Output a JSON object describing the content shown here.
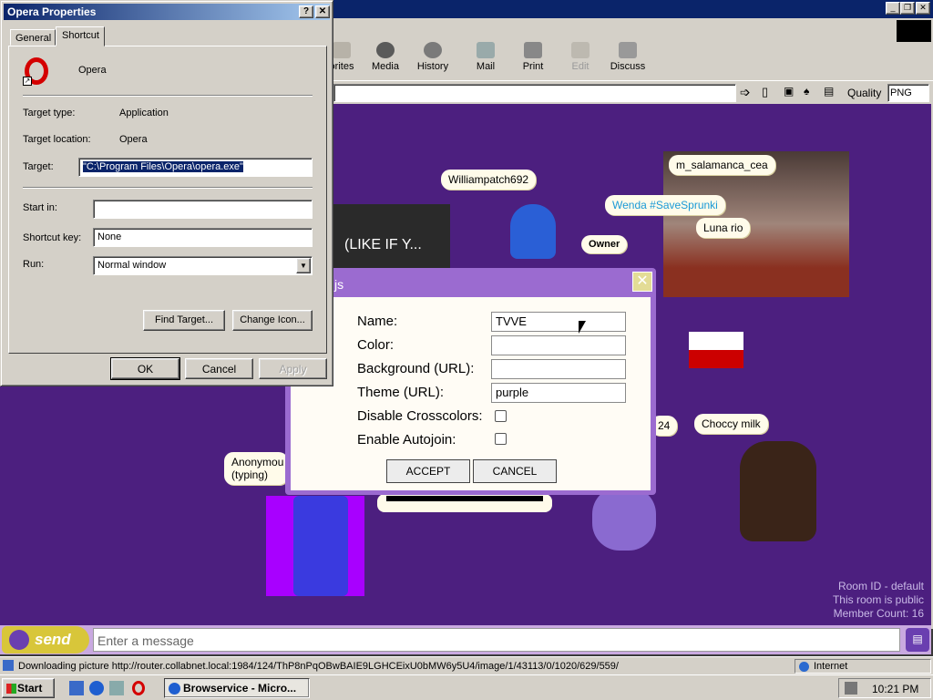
{
  "browser": {
    "toolbar": [
      "orites",
      "Media",
      "History",
      "Mail",
      "Print",
      "Edit",
      "Discuss"
    ],
    "quality_label": "Quality",
    "quality_value": "PNG"
  },
  "chat": {
    "bubbles": {
      "williampatch": "Williampatch692",
      "msalamanca": "m_salamanca_cea",
      "wenda": "Wenda #SaveSprunki",
      "luna": "Luna rio",
      "owner": "Owner",
      "choccy": "Choccy milk",
      "anon_name": "Anonymou",
      "anon_status": "(typing)",
      "like": "(LIKE IF Y...",
      "num24": "24"
    },
    "room_id": "Room ID - default",
    "room_public": "This room is public",
    "member_count": "Member Count: 16",
    "send_label": "send",
    "message_placeholder": "Enter a message"
  },
  "props": {
    "title": "Opera Properties",
    "tabs": [
      "General",
      "Shortcut"
    ],
    "app_name": "Opera",
    "target_type_label": "Target type:",
    "target_type_value": "Application",
    "target_location_label": "Target location:",
    "target_location_value": "Opera",
    "target_label": "Target:",
    "target_value": "\"C:\\Program Files\\Opera\\opera.exe\"",
    "start_in_label": "Start in:",
    "start_in_value": "",
    "shortcut_key_label": "Shortcut key:",
    "shortcut_key_value": "None",
    "run_label": "Run:",
    "run_value": "Normal window",
    "find_target": "Find Target...",
    "change_icon": "Change Icon...",
    "ok": "OK",
    "cancel": "Cancel",
    "apply": "Apply"
  },
  "room_settings": {
    "title_fragment": "js",
    "name_label": "Name:",
    "name_value": "TVVE",
    "color_label": "Color:",
    "color_value": "",
    "background_label": "Background (URL):",
    "background_value": "",
    "theme_label": "Theme (URL):",
    "theme_value": "purple",
    "disable_crosscolors_label": "Disable Crosscolors:",
    "enable_autojoin_label": "Enable Autojoin:",
    "accept": "ACCEPT",
    "cancel": "CANCEL"
  },
  "status": {
    "text": "Downloading picture http://router.collabnet.local:1984/124/ThP8nPqOBwBAIE9LGHCEixU0bMW6y5U4/image/1/43113/0/1020/629/559/...",
    "zone": "Internet"
  },
  "taskbar": {
    "start": "Start",
    "task": "Browservice - Micro...",
    "clock": "10:21 PM"
  },
  "colors": {
    "chat_bg": "#4c1f7f",
    "bubble_bg": "#fffbea",
    "title_bar": "#0a246a"
  }
}
